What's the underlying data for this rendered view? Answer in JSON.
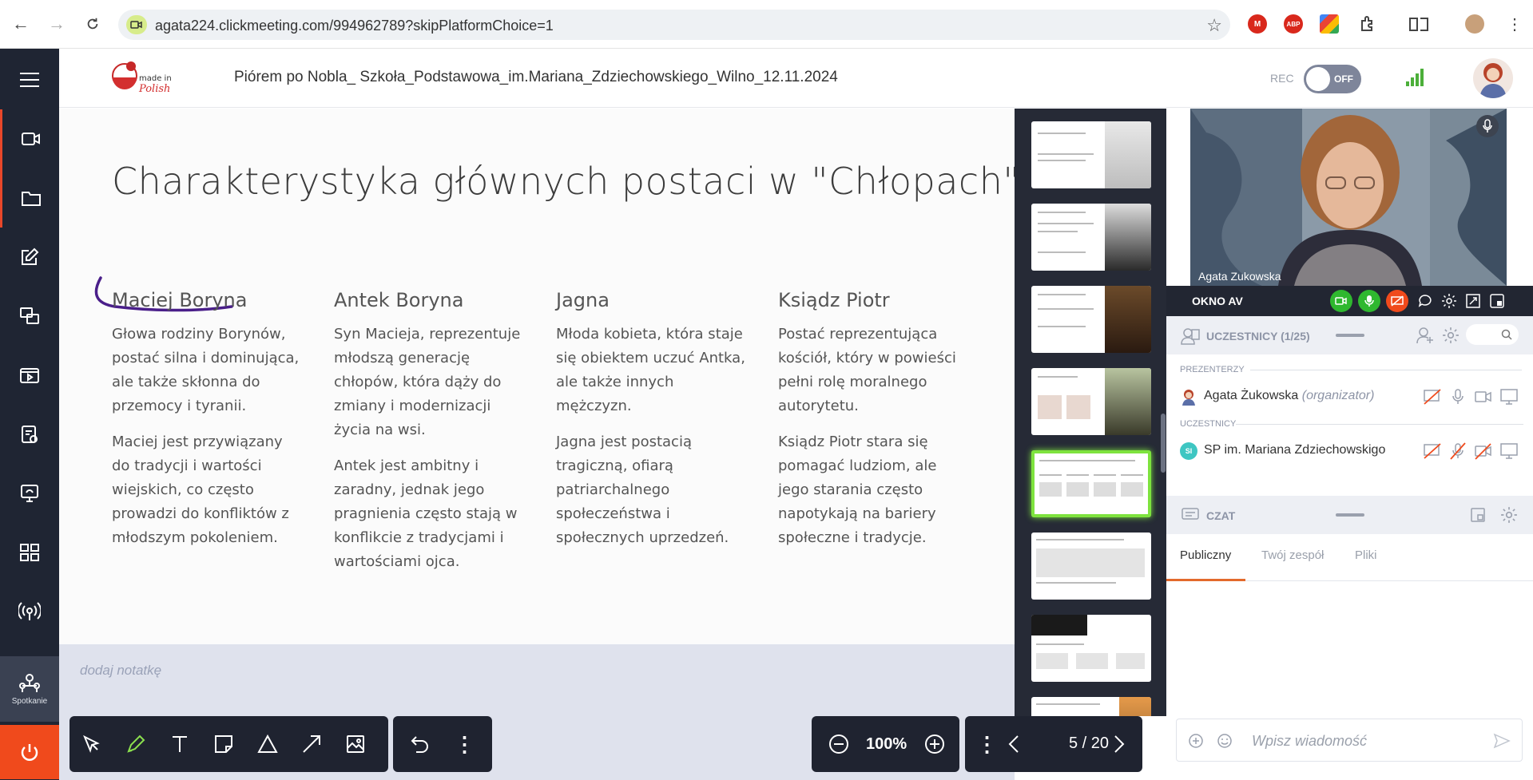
{
  "browser": {
    "url": "agata224.clickmeeting.com/994962789?skipPlatformChoice=1"
  },
  "header": {
    "logo_text": "made in Polish",
    "meeting_title": "Piórem po Nobla_ Szkoła_Podstawowa_im.Mariana_Zdziechowskiego_Wilno_12.11.2024",
    "rec_label": "REC",
    "rec_state": "OFF"
  },
  "sidebar": {
    "meeting_label": "Spotkanie"
  },
  "slide": {
    "title": "Charakterystyka głównych postaci w \"Chłopach\"",
    "columns": [
      {
        "heading": "Maciej Boryna",
        "paragraphs": [
          "Głowa rodziny Borynów, postać silna i dominująca, ale także skłonna do przemocy i tyranii.",
          "Maciej jest przywiązany do tradycji i wartości wiejskich, co często prowadzi do konfliktów z młodszym pokoleniem."
        ]
      },
      {
        "heading": "Antek Boryna",
        "paragraphs": [
          "Syn Macieja, reprezentuje młodszą generację chłopów, która dąży do zmiany i modernizacji życia na wsi.",
          "Antek jest ambitny i zaradny, jednak jego pragnienia często stają w konflikcie z tradycjami i wartościami ojca."
        ]
      },
      {
        "heading": "Jagna",
        "paragraphs": [
          "Młoda kobieta, która staje się obiektem uczuć Antka, ale także innych mężczyzn.",
          "Jagna jest postacią tragiczną, ofiarą patriarchalnego społeczeństwa i społecznych uprzedzeń."
        ]
      },
      {
        "heading": "Ksiądz Piotr",
        "paragraphs": [
          "Postać reprezentująca kościół, który w powieści pełni rolę moralnego autorytetu.",
          "Ksiądz Piotr stara się pomagać ludziom, ale jego starania często napotykają na bariery społeczne i tradycje."
        ]
      }
    ],
    "notes_placeholder": "dodaj notatkę"
  },
  "toolbar": {
    "zoom": "100%",
    "page": "5 / 20"
  },
  "video": {
    "presenter_name": "Agata Zukowska",
    "av_label": "OKNO AV"
  },
  "participants": {
    "title": "UCZESTNICY (1/25)",
    "presenters_label": "PREZENTERZY",
    "participants_label": "UCZESTNICY",
    "presenter": {
      "name": "Agata Żukowska",
      "role": "(organizator)"
    },
    "attendee": {
      "initials": "SI",
      "name": "SP im. Mariana Zdziechowskigo"
    }
  },
  "chat": {
    "title": "CZAT",
    "tabs": [
      "Publiczny",
      "Twój zespół",
      "Pliki"
    ],
    "input_placeholder": "Wpisz wiadomość"
  },
  "colors": {
    "sidebar_bg": "#1f2533",
    "accent_power": "#f04a1c",
    "active_thumb": "#7ee33e",
    "av_green": "#2fb82f",
    "av_red": "#f04a1c",
    "annotation": "#4a1f8a"
  }
}
